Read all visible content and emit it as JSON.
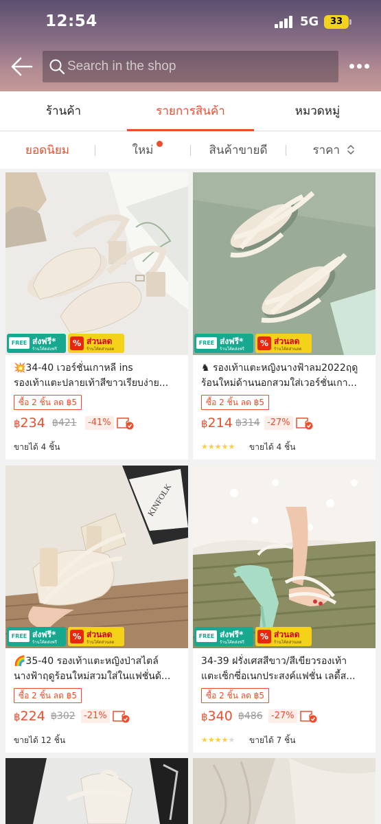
{
  "status": {
    "time": "12:54",
    "network": "5G",
    "battery": "33"
  },
  "header": {
    "search_placeholder": "Search in the shop"
  },
  "tabs": [
    {
      "label": "ร้านค้า"
    },
    {
      "label": "รายการสินค้า"
    },
    {
      "label": "หมวดหมู่"
    }
  ],
  "sort": [
    {
      "label": "ยอดนิยม"
    },
    {
      "label": "ใหม่"
    },
    {
      "label": "สินค้าขายดี"
    },
    {
      "label": "ราคา"
    }
  ],
  "badges": {
    "free_tag": "FREE",
    "free_title": "ส่งฟรี*",
    "free_sub": "ร้านโค้ดส่งฟรี",
    "sale_icon": "%",
    "sale_title": "ส่วนลด",
    "sale_sub": "ร้านโค้ดส่วนลด"
  },
  "products": [
    {
      "title_line1": "💥34-40 เวอร์ชั่นเกาหลี ins",
      "title_line2": "รองเท้าแตะปลายเท้าสีขาวเรียบง่าย...",
      "promo": "ซื้อ 2 ชิ้น ลด ฿5",
      "currency": "฿",
      "price": "234",
      "old_price": "฿421",
      "discount": "-41%",
      "rating": 0,
      "sold": "ขายได้ 4 ชิ้น"
    },
    {
      "title_line1": "♞ รองเท้าแตะหญิงนางฟ้าลม2022ฤดู",
      "title_line2": "ร้อนใหม่ด้านนอกสวมใส่เวอร์ชั่นเกา...",
      "promo": "ซื้อ 2 ชิ้น ลด ฿5",
      "currency": "฿",
      "price": "214",
      "old_price": "฿314",
      "discount": "-27%",
      "rating": 5,
      "sold": "ขายได้ 4 ชิ้น"
    },
    {
      "title_line1": "🌈35-40 รองเท้าแตะหญิงป่าสไตล์",
      "title_line2": "นางฟ้าฤดูร้อนใหม่สวมใส่ในแฟชั่นด้...",
      "promo": "ซื้อ 2 ชิ้น ลด ฿5",
      "currency": "฿",
      "price": "224",
      "old_price": "฿302",
      "discount": "-21%",
      "rating": 0,
      "sold": "ขายได้ 12 ชิ้น"
    },
    {
      "title_line1": "34-39 ฝรั่งเศสสีขาว/สีเขียวรองเท้า",
      "title_line2": "แตะเซ็กซี่อเนกประสงค์แฟชั่น เลดี้ส...",
      "promo": "ซื้อ 2 ชิ้น ลด ฿5",
      "currency": "฿",
      "price": "340",
      "old_price": "฿486",
      "discount": "-27%",
      "rating": 4,
      "sold": "ขายได้ 7 ชิ้น"
    }
  ],
  "photo_text": {
    "box_brand": "KINFOLK"
  }
}
